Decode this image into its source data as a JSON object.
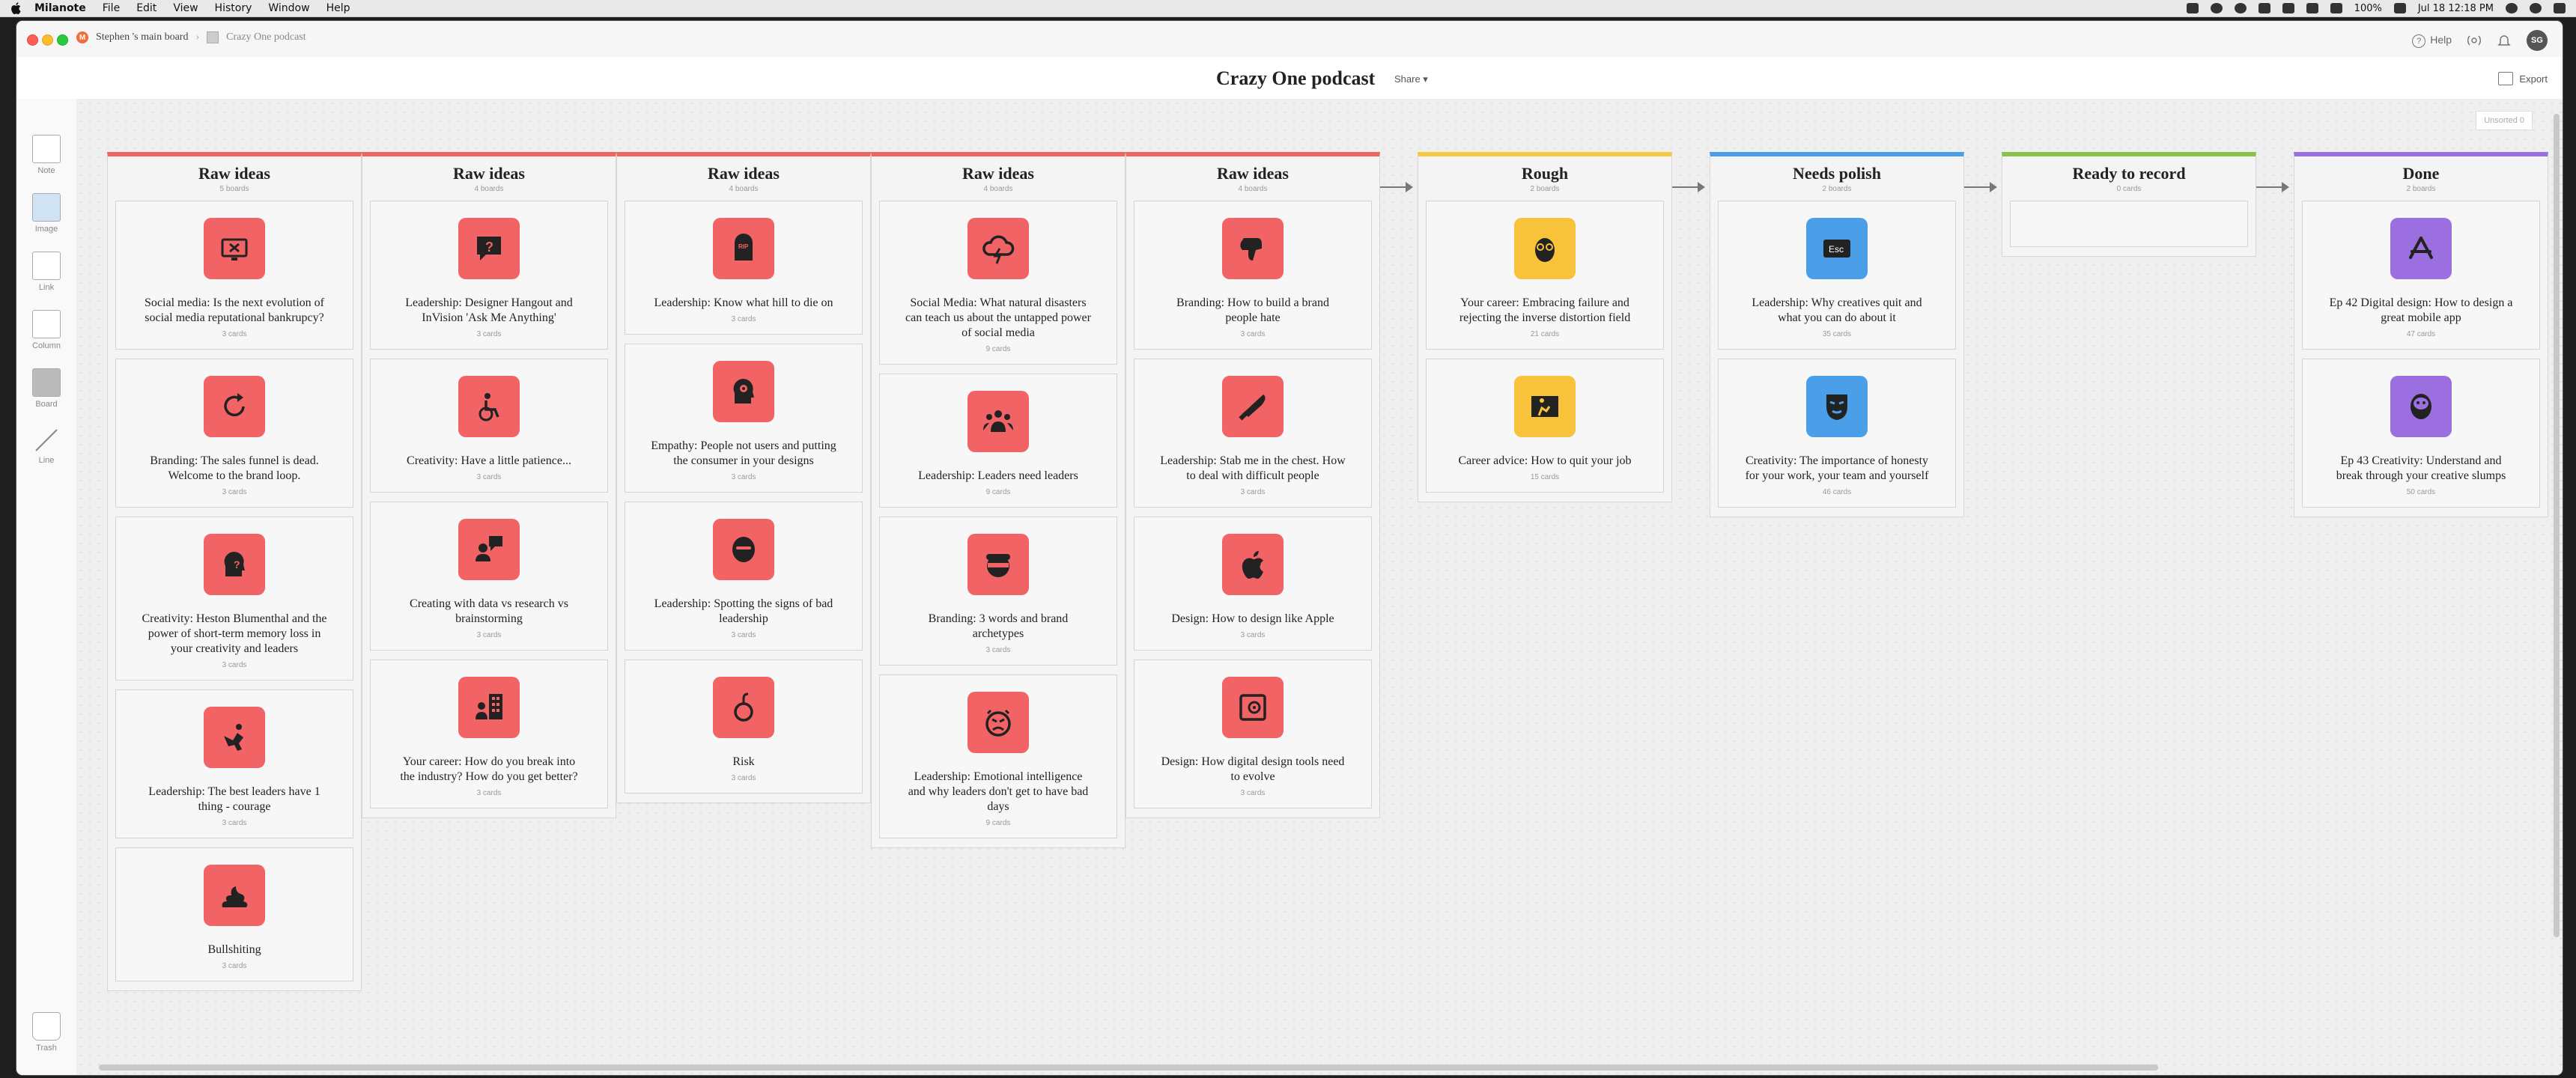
{
  "menubar": {
    "app": "Milanote",
    "items": [
      "File",
      "Edit",
      "View",
      "History",
      "Window",
      "Help"
    ],
    "battery": "100%",
    "datetime": "Jul 18  12:18 PM"
  },
  "window": {
    "breadcrumb_root": "Stephen 's main board",
    "breadcrumb_current": "Crazy One podcast",
    "help_label": "Help",
    "avatar_initials": "SG"
  },
  "board": {
    "title": "Crazy One podcast",
    "share_label": "Share ▾",
    "export_label": "Export",
    "unsorted_label": "Unsorted 0"
  },
  "toolbar": {
    "tools": [
      {
        "label": "Note"
      },
      {
        "label": "Image"
      },
      {
        "label": "Link"
      },
      {
        "label": "Column"
      },
      {
        "label": "Board"
      },
      {
        "label": "Line"
      },
      {
        "label": "Trash"
      }
    ]
  },
  "colors": {
    "raw": "#f06363",
    "rough": "#f5c842",
    "polish": "#4a9fe8",
    "ready": "#8bc34a",
    "done": "#9c6fe0",
    "card_red": "#f26366",
    "card_yellow": "#f8c33a",
    "card_blue": "#4a9fe8",
    "card_purple": "#9c6fe0"
  },
  "columns": [
    {
      "title": "Raw ideas",
      "subtitle": "5 boards",
      "cards": [
        {
          "title": "Social media: Is the next evolution of social media reputational bankrupcy?",
          "count": "3 cards",
          "icon": "monitor-x-icon"
        },
        {
          "title": "Branding: The sales funnel is dead. Welcome to the brand loop.",
          "count": "3 cards",
          "icon": "refresh-icon"
        },
        {
          "title": "Creativity: Heston Blumenthal and the power of short-term memory loss in your creativity and leaders",
          "count": "3 cards",
          "icon": "head-question-icon"
        },
        {
          "title": "Leadership: The best leaders have 1 thing - courage",
          "count": "3 cards",
          "icon": "jumping-person-icon"
        },
        {
          "title": "Bullshiting",
          "count": "3 cards",
          "icon": "poop-icon"
        }
      ]
    },
    {
      "title": "Raw ideas",
      "subtitle": "4 boards",
      "cards": [
        {
          "title": "Leadership: Designer Hangout and InVision 'Ask Me Anything'",
          "count": "3 cards",
          "icon": "question-bubble-icon"
        },
        {
          "title": "Creativity: Have a little patience...",
          "count": "3 cards",
          "icon": "wheelchair-icon"
        },
        {
          "title": "Creating with data vs research vs brainstorming",
          "count": "3 cards",
          "icon": "person-speech-icon"
        },
        {
          "title": "Your career: How do you break into the industry? How do you get better?",
          "count": "3 cards",
          "icon": "person-building-icon"
        }
      ]
    },
    {
      "title": "Raw ideas",
      "subtitle": "4 boards",
      "cards": [
        {
          "title": "Leadership: Know what hill to die on",
          "count": "3 cards",
          "icon": "tombstone-icon"
        },
        {
          "title": "Empathy: People not users and putting the consumer in your designs",
          "count": "3 cards",
          "icon": "head-gears-icon"
        },
        {
          "title": "Leadership: Spotting the signs of bad leadership",
          "count": "3 cards",
          "icon": "mask-face-icon"
        },
        {
          "title": "Risk",
          "count": "3 cards",
          "icon": "bomb-icon"
        }
      ]
    },
    {
      "title": "Raw ideas",
      "subtitle": "4 boards",
      "cards": [
        {
          "title": "Social Media: What natural disasters can teach us about the untapped power of social media",
          "count": "9 cards",
          "icon": "storm-cloud-icon"
        },
        {
          "title": "Leadership: Leaders need leaders",
          "count": "9 cards",
          "icon": "group-icon"
        },
        {
          "title": "Branding: 3 words and brand archetypes",
          "count": "3 cards",
          "icon": "helmet-face-icon"
        },
        {
          "title": "Leadership: Emotional intelligence and why leaders don't get to have bad days",
          "count": "9 cards",
          "icon": "angry-face-icon"
        }
      ]
    },
    {
      "title": "Raw ideas",
      "subtitle": "4 boards",
      "cards": [
        {
          "title": "Branding: How to build a brand people hate",
          "count": "3 cards",
          "icon": "thumbs-down-icon"
        },
        {
          "title": "Leadership: Stab me in the chest. How to deal with difficult people",
          "count": "3 cards",
          "icon": "knife-icon"
        },
        {
          "title": "Design: How to design like Apple",
          "count": "3 cards",
          "icon": "apple-icon"
        },
        {
          "title": "Design: How digital design tools need to evolve",
          "count": "3 cards",
          "icon": "safe-icon"
        }
      ]
    },
    {
      "title": "Rough",
      "subtitle": "2 boards",
      "cards": [
        {
          "title": "Your career: Embracing failure and rejecting the inverse distortion field",
          "count": "21 cards",
          "icon": "glasses-face-icon"
        },
        {
          "title": "Career advice: How to quit your job",
          "count": "15 cards",
          "icon": "exit-sign-icon"
        }
      ]
    },
    {
      "title": "Needs polish",
      "subtitle": "2 boards",
      "cards": [
        {
          "title": "Leadership: Why creatives quit and what you can do about it",
          "count": "35 cards",
          "icon": "escape-key-icon"
        },
        {
          "title": "Creativity: The importance of honesty for your work, your team and yourself",
          "count": "46 cards",
          "icon": "theatre-mask-icon"
        }
      ]
    },
    {
      "title": "Ready to record",
      "subtitle": "0 cards",
      "cards": []
    },
    {
      "title": "Done",
      "subtitle": "2 boards",
      "cards": [
        {
          "title": "Ep 42 Digital design: How to design a great mobile app",
          "count": "47 cards",
          "icon": "app-store-icon"
        },
        {
          "title": "Ep 43 Creativity: Understand and break through your creative slumps",
          "count": "50 cards",
          "icon": "bearded-face-icon"
        }
      ]
    }
  ]
}
